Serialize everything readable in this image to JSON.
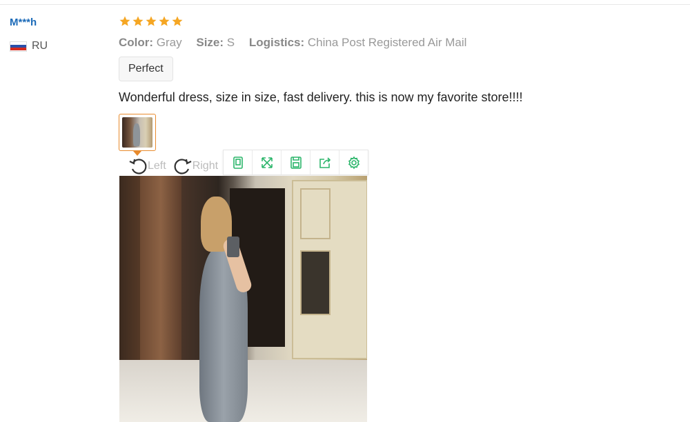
{
  "reviewer": {
    "name": "M***h",
    "country_code": "RU",
    "flag_colors": [
      "#ffffff",
      "#2a4fa8",
      "#d52b1e"
    ]
  },
  "rating": {
    "stars": 5,
    "max": 5,
    "color": "#f5a623"
  },
  "attributes": [
    {
      "label": "Color:",
      "value": "Gray"
    },
    {
      "label": "Size:",
      "value": "S"
    },
    {
      "label": "Logistics:",
      "value": "China Post Registered Air Mail"
    }
  ],
  "tag": "Perfect",
  "review_text": "Wonderful dress, size in size, fast delivery. this is now my favorite store!!!!",
  "image_viewer": {
    "rotate_left_label": "Left",
    "rotate_right_label": "Right",
    "toolbar_icons": [
      "fit-icon",
      "fullscreen-icon",
      "save-icon",
      "share-icon",
      "settings-icon"
    ],
    "accent_color": "#2bb56a",
    "thumbnail_border_color": "#e88a2c"
  }
}
